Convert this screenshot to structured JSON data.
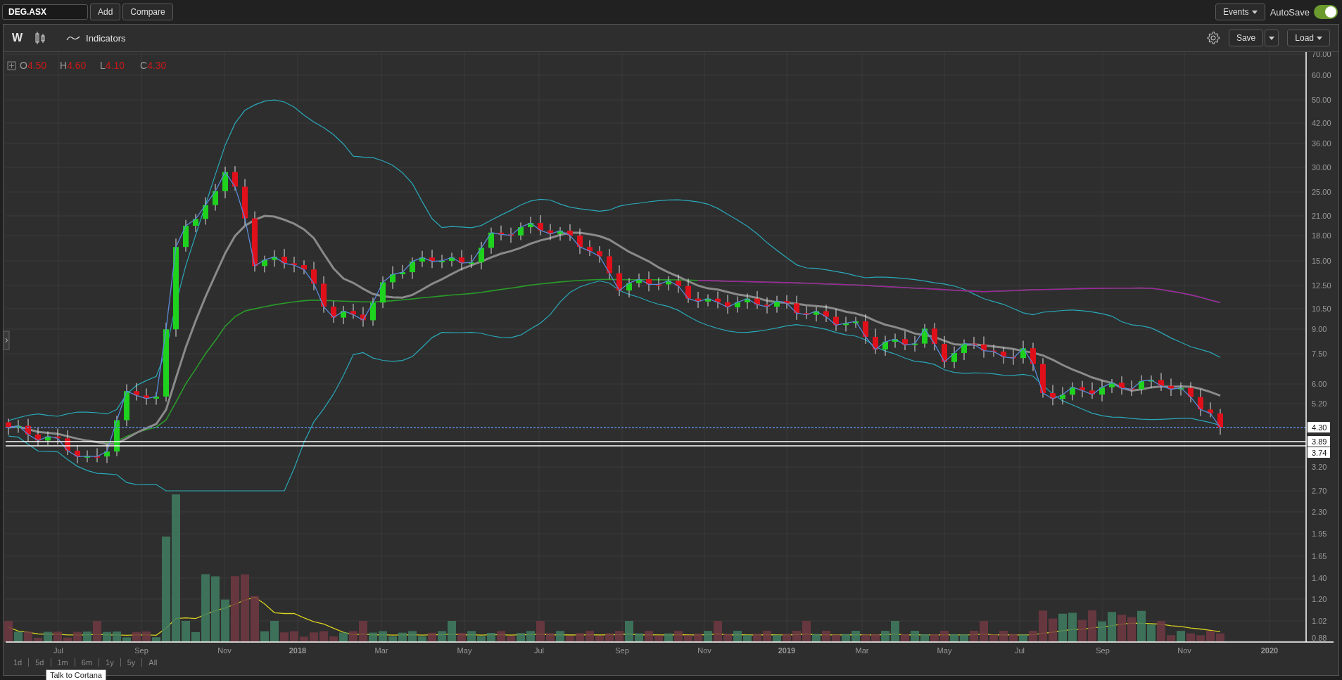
{
  "symbol_field": {
    "value": "DEG.ASX"
  },
  "top_buttons": [
    "Add",
    "Compare"
  ],
  "events_button": {
    "label": "Events"
  },
  "autosave": {
    "label": "AutoSave",
    "on": true
  },
  "toolbar": {
    "period": "W",
    "indicators": "Indicators",
    "save": "Save",
    "load": "Load"
  },
  "legend": [
    {
      "key": "O",
      "value": "4.50"
    },
    {
      "key": "H",
      "value": "4.60"
    },
    {
      "key": "L",
      "value": "4.10"
    },
    {
      "key": "C",
      "value": "4.30"
    }
  ],
  "y_axis_labels": [
    "70.00",
    "60.00",
    "50.00",
    "42.00",
    "36.00",
    "30.00",
    "25.00",
    "21.00",
    "18.00",
    "15.00",
    "12.50",
    "10.50",
    "9.00",
    "7.50",
    "6.00",
    "5.20",
    "3.20",
    "2.70",
    "2.30",
    "1.95",
    "1.65",
    "1.40",
    "1.20",
    "1.02",
    "0.88"
  ],
  "price_markers": [
    {
      "label": "4.30",
      "kind": "current"
    },
    {
      "label": "3.89",
      "kind": "level"
    },
    {
      "label": "3.74",
      "kind": "level"
    }
  ],
  "x_axis_labels": [
    {
      "label": "Jul",
      "bold": false
    },
    {
      "label": "Sep",
      "bold": false
    },
    {
      "label": "Nov",
      "bold": false
    },
    {
      "label": "2018",
      "bold": true
    },
    {
      "label": "Mar",
      "bold": false
    },
    {
      "label": "May",
      "bold": false
    },
    {
      "label": "Jul",
      "bold": false
    },
    {
      "label": "Sep",
      "bold": false
    },
    {
      "label": "Nov",
      "bold": false
    },
    {
      "label": "2019",
      "bold": true
    },
    {
      "label": "Mar",
      "bold": false
    },
    {
      "label": "May",
      "bold": false
    },
    {
      "label": "Jul",
      "bold": false
    },
    {
      "label": "Sep",
      "bold": false
    },
    {
      "label": "Nov",
      "bold": false
    },
    {
      "label": "2020",
      "bold": true
    }
  ],
  "ranges": [
    "1d",
    "5d",
    "1m",
    "6m",
    "1y",
    "5y",
    "All"
  ],
  "tooltip": "Talk to Cortana"
}
